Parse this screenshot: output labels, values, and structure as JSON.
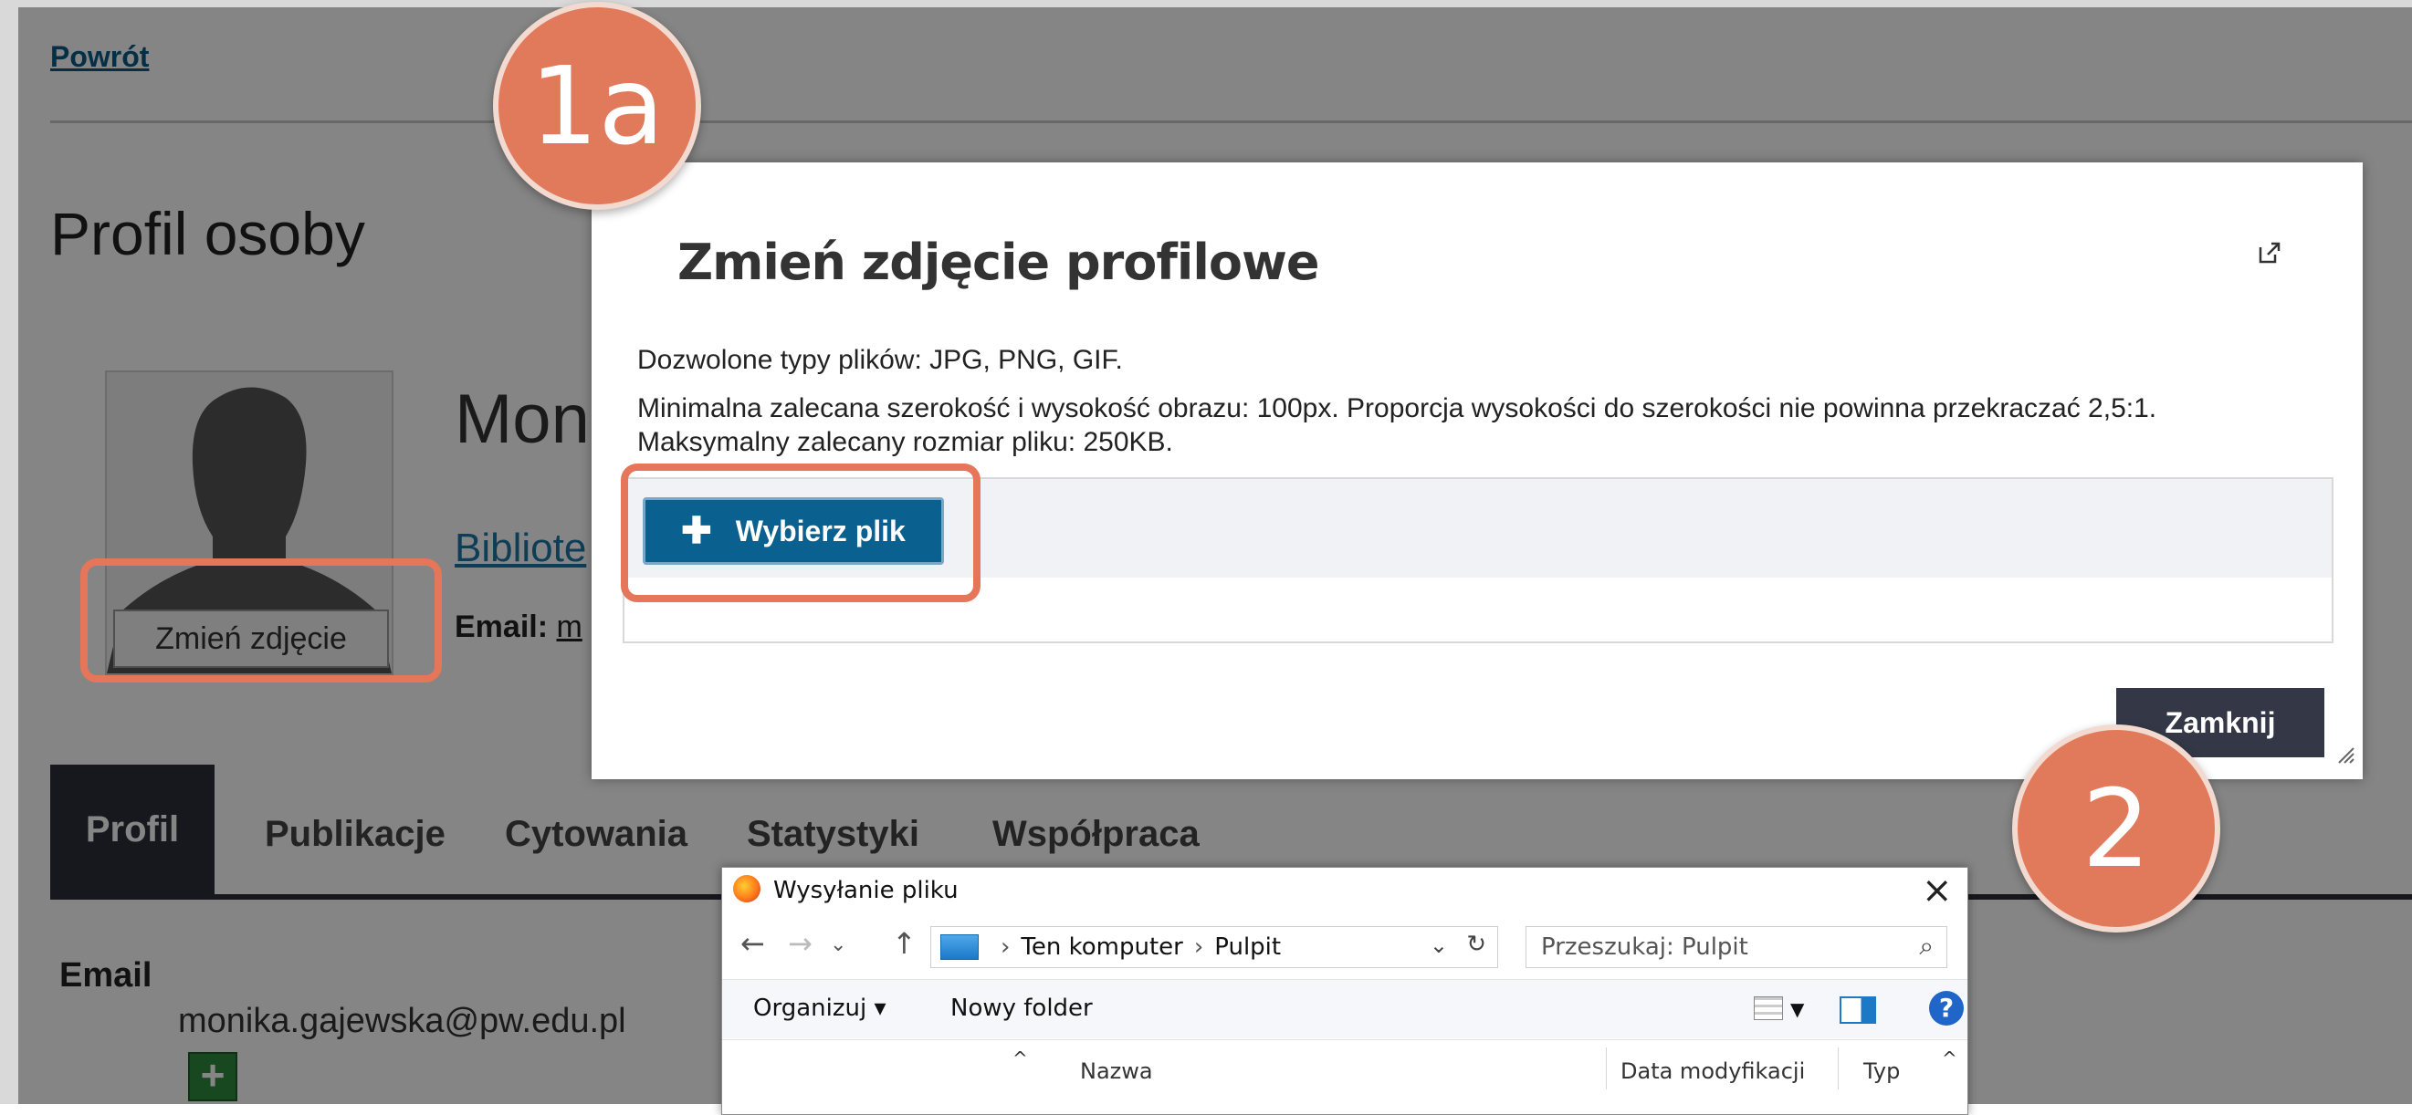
{
  "page": {
    "back_link": "Powrót",
    "title": "Profil osoby",
    "person_name": "Mon",
    "library_link": "Bibliote",
    "email_label": "Email:",
    "email_link_fragment": "m",
    "change_photo_button": "Zmień zdjęcie"
  },
  "tabs": [
    "Profil",
    "Publikacje",
    "Cytowania",
    "Statystyki",
    "Współpraca"
  ],
  "email_section": {
    "label": "Email",
    "value": "monika.gajewska@pw.edu.pl",
    "add_icon": "plus-icon"
  },
  "modal": {
    "title": "Zmień zdjęcie profilowe",
    "expand_icon": "external-link-icon",
    "allowed_types": "Dozwolone typy plików: JPG, PNG, GIF.",
    "min_size": "Minimalna zalecana szerokość i wysokość obrazu: 100px. Proporcja wysokości do szerokości nie powinna przekraczać 2,5:1.",
    "max_size": "Maksymalny zalecany rozmiar pliku: 250KB.",
    "choose_file_button": "Wybierz plik",
    "close_button": "Zamknij"
  },
  "file_dialog": {
    "title": "Wysyłanie pliku",
    "path": [
      "Ten komputer",
      "Pulpit"
    ],
    "search_placeholder": "Przeszukaj: Pulpit",
    "organize": "Organizuj ▾",
    "new_folder": "Nowy folder",
    "columns": [
      "Nazwa",
      "Data modyfikacji",
      "Typ"
    ]
  },
  "callouts": {
    "step_1a": "1a",
    "step_2": "2"
  },
  "colors": {
    "callout": "#e07a5a",
    "primary_button": "#0a6190",
    "dark_button": "#343746",
    "tab_active": "#2d2f3b"
  }
}
